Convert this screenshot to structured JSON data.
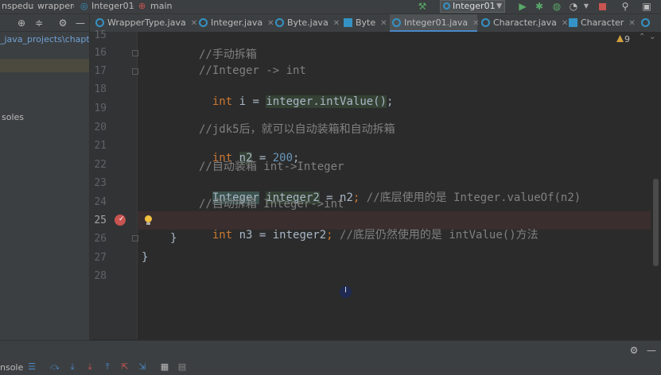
{
  "topbar": {
    "crumbs": [
      "nspedu",
      "wrapper",
      "Integer01",
      "main"
    ],
    "run_config": "Integer01"
  },
  "project": {
    "rows": [
      "_java_projects\\chapter",
      "soles"
    ]
  },
  "tabs": [
    {
      "label": "WrapperType.java",
      "active": false
    },
    {
      "label": "Integer.java",
      "active": false
    },
    {
      "label": "Byte.java",
      "active": false
    },
    {
      "label": "Byte",
      "active": false
    },
    {
      "label": "Integer01.java",
      "active": true
    },
    {
      "label": "Character.java",
      "active": false
    },
    {
      "label": "Character",
      "active": false
    }
  ],
  "editor": {
    "warnings_count": "9",
    "current_line": "25",
    "lines": [
      {
        "n": "15",
        "text": ""
      },
      {
        "n": "16",
        "text": "//手动拆箱"
      },
      {
        "n": "17",
        "text": "//Integer -> int"
      },
      {
        "n": "18",
        "text": "int i = integer.intValue();"
      },
      {
        "n": "19",
        "text": ""
      },
      {
        "n": "20",
        "text": "//jdk5后，就可以自动装箱和自动拆箱"
      },
      {
        "n": "21",
        "text": "int n2 = 200;"
      },
      {
        "n": "22",
        "text": "//自动装箱 int->Integer"
      },
      {
        "n": "23",
        "text": "Integer integer2 = n2; //底层使用的是 Integer.valueOf(n2)"
      },
      {
        "n": "24",
        "text": "//自动拆箱 Integer->int"
      },
      {
        "n": "25",
        "text": "int n3 = integer2; //底层仍然使用的是 intValue()方法"
      },
      {
        "n": "26",
        "text": "}"
      },
      {
        "n": "27",
        "text": "}"
      },
      {
        "n": "28",
        "text": ""
      }
    ]
  },
  "bottom": {
    "tab_label": "nsole"
  },
  "colors": {
    "keyword": "#cc7832",
    "comment": "#808080",
    "number": "#6897bb",
    "breakpoint": "#c75450",
    "accent": "#4a88c7"
  }
}
